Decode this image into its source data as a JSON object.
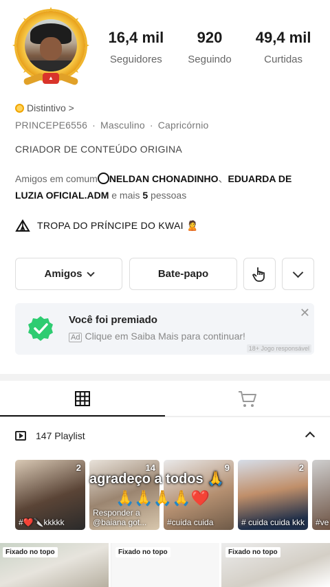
{
  "profile": {
    "stats": [
      {
        "value": "16,4 mil",
        "label": "Seguidores"
      },
      {
        "value": "920",
        "label": "Seguindo"
      },
      {
        "value": "49,4 mil",
        "label": "Curtidas"
      }
    ],
    "badge_link": "Distintivo >",
    "username": "PRINCEPE6556",
    "gender": "Masculino",
    "sign": "Capricórnio",
    "bio": "CRIADOR DE CONTEÚDO ORIGINA",
    "mutual_prefix": "Amigos em comum",
    "mutual_name_1": "NELDAN CHONADINHO",
    "mutual_sep": "、",
    "mutual_name_2": "EDUARDA DE LUZIA OFICIAL.ADM",
    "mutual_suffix_a": " e mais ",
    "mutual_count": "5",
    "mutual_suffix_b": " pessoas",
    "group": "TROPA DO PRÍNCIPE DO  KWAI 🙎"
  },
  "actions": {
    "friends_label": "Amigos",
    "chat_label": "Bate-papo"
  },
  "award": {
    "title": "Você foi premiado",
    "ad_tag": "Ad",
    "subtitle": "Clique em Saiba Mais para continuar!",
    "age_note": "18+ Jogo responsável",
    "close": "✕"
  },
  "playlist": {
    "header": "147 Playlist",
    "items": [
      {
        "count": "2",
        "caption": "#❤️🔪kkkkk"
      },
      {
        "count": "14",
        "caption": "Responder a @baiana got..."
      },
      {
        "count": "9",
        "caption": "#cuida cuida"
      },
      {
        "count": "2",
        "caption": "# cuida cuida kkk"
      },
      {
        "count": "",
        "caption": "#ve"
      }
    ],
    "overlay_text": "agradeço a todos 🙏",
    "hearts": "🙏🙏🙏🙏❤️"
  },
  "pinned": {
    "label": "Fixado no topo"
  },
  "colors": {
    "accent_gold": "#f0b52c",
    "check_green": "#2ecc71",
    "heart_red": "#e0212f"
  }
}
